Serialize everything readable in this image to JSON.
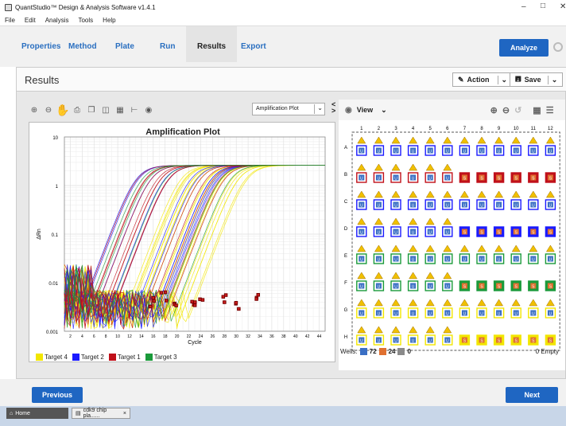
{
  "window": {
    "title": "QuantStudio™ Design & Analysis Software v1.4.1"
  },
  "menu": [
    "File",
    "Edit",
    "Analysis",
    "Tools",
    "Help"
  ],
  "tabs": [
    "Properties",
    "Method",
    "Plate",
    "Run",
    "Results",
    "Export"
  ],
  "active_tab": "Results",
  "analyze_label": "Analyze",
  "results": {
    "title": "Results",
    "action_label": "Action",
    "save_label": "Save"
  },
  "plot_select": "Amplification Plot",
  "view_label": "View",
  "chart_data": {
    "type": "line",
    "title": "Amplification Plot",
    "xlabel": "Cycle",
    "ylabel": "ΔRn",
    "yscale": "log",
    "ylim": [
      0.001,
      10
    ],
    "xlim": [
      1,
      45
    ],
    "yticks": [
      "10",
      "1",
      "0.1",
      "0.01",
      "0.001"
    ],
    "xticks": [
      "2",
      "4",
      "6",
      "8",
      "10",
      "12",
      "14",
      "16",
      "18",
      "20",
      "22",
      "24",
      "26",
      "28",
      "30",
      "32",
      "34",
      "36",
      "38",
      "40",
      "42",
      "44"
    ],
    "grid": true,
    "series": [
      {
        "name": "Target 4",
        "color": "#f2e600",
        "ct_range": [
          20,
          33
        ]
      },
      {
        "name": "Target 2",
        "color": "#1a1aff",
        "ct_range": [
          13,
          29
        ]
      },
      {
        "name": "Target 1",
        "color": "#c0101a",
        "ct_range": [
          13,
          29
        ]
      },
      {
        "name": "Target 3",
        "color": "#1a9a3a",
        "ct_range": [
          13,
          29
        ]
      }
    ]
  },
  "plate": {
    "columns": [
      "1",
      "2",
      "3",
      "4",
      "5",
      "6",
      "7",
      "8",
      "9",
      "10",
      "11",
      "12"
    ],
    "rows": [
      "A",
      "B",
      "C",
      "D",
      "E",
      "F",
      "G",
      "H"
    ],
    "well_letter": "U",
    "well_letter_s": "S",
    "layout": [
      [
        "U",
        "U",
        "U",
        "U",
        "U",
        "U",
        "U",
        "U",
        "U",
        "U",
        "U",
        "U"
      ],
      [
        "U",
        "U",
        "U",
        "U",
        "U",
        "U",
        "S",
        "S",
        "S",
        "S",
        "S",
        "S"
      ],
      [
        "U",
        "U",
        "U",
        "U",
        "U",
        "U",
        "U",
        "U",
        "U",
        "U",
        "U",
        "U"
      ],
      [
        "U",
        "U",
        "U",
        "U",
        "U",
        "U",
        "S",
        "S",
        "S",
        "S",
        "S",
        "S"
      ],
      [
        "U",
        "U",
        "U",
        "U",
        "U",
        "U",
        "U",
        "U",
        "U",
        "U",
        "U",
        "U"
      ],
      [
        "U",
        "U",
        "U",
        "U",
        "U",
        "U",
        "S",
        "S",
        "S",
        "S",
        "S",
        "S"
      ],
      [
        "U",
        "U",
        "U",
        "U",
        "U",
        "U",
        "U",
        "U",
        "U",
        "U",
        "U",
        "U"
      ],
      [
        "U",
        "U",
        "U",
        "U",
        "U",
        "U",
        "S",
        "S",
        "S",
        "S",
        "S",
        "S"
      ]
    ],
    "border_colors": [
      "#1a1aff",
      "#c0101a",
      "#1a1aff",
      "#1a1aff",
      "#1a9a3a",
      "#1a9a3a",
      "#f2e600",
      "#f2e600"
    ]
  },
  "wells": {
    "label": "Wells:",
    "u_count": "72",
    "s_count": "24",
    "n_count": "0",
    "empty": "0 Empty"
  },
  "nav": {
    "previous": "Previous",
    "next": "Next"
  },
  "taskbar": {
    "home": "Home",
    "file": "cdk9 chip pla......"
  }
}
